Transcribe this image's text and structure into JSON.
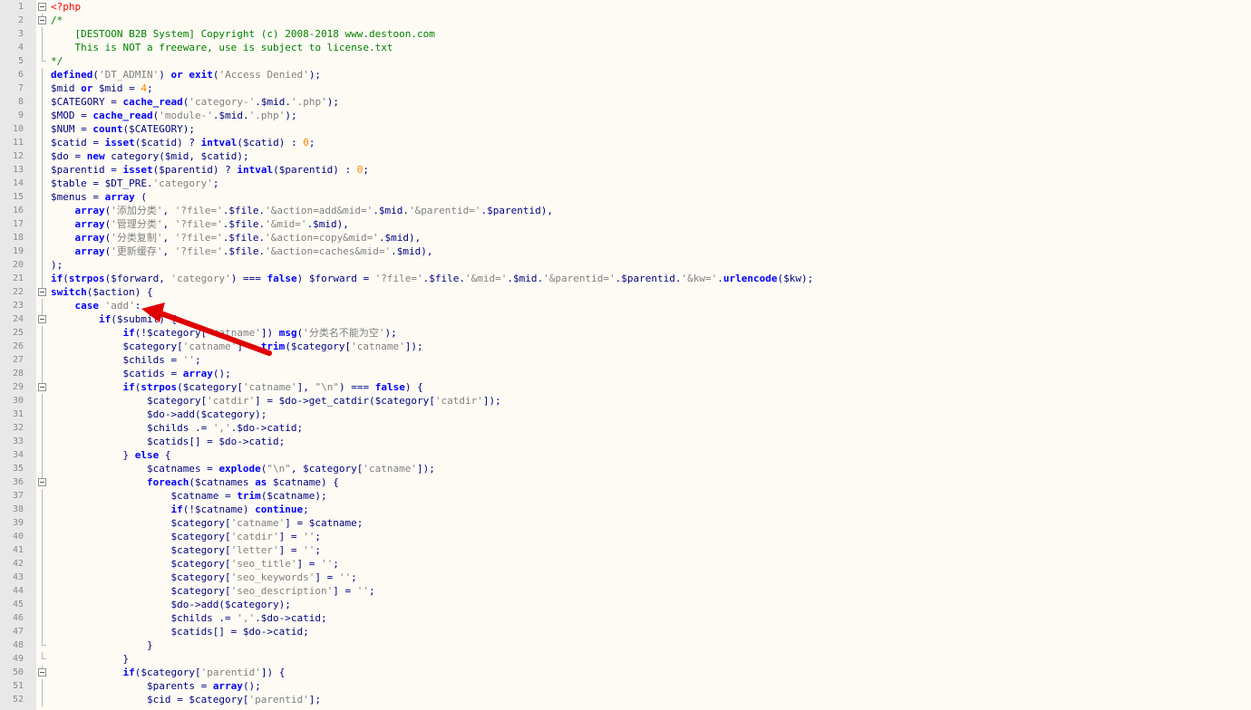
{
  "editor": {
    "colors": {
      "keyword": "#0000ff",
      "string": "#808080",
      "comment": "#008000",
      "php_tag": "#ff0000",
      "plain": "#000080",
      "number": "#ff8000",
      "annotation_arrow": "#e00000"
    },
    "lines": [
      {
        "n": "1",
        "text": "<?php",
        "fold": "box",
        "indent": 0
      },
      {
        "n": "2",
        "text": "/*",
        "fold": "box",
        "indent": 0
      },
      {
        "n": "3",
        "text": "    [DESTOON B2B System] Copyright (c) 2008-2018 www.destoon.com",
        "fold": "bar",
        "indent": 0
      },
      {
        "n": "4",
        "text": "    This is NOT a freeware, use is subject to license.txt",
        "fold": "bar",
        "indent": 0
      },
      {
        "n": "5",
        "text": "*/",
        "fold": "end",
        "indent": 0
      },
      {
        "n": "6",
        "text": "defined('DT_ADMIN') or exit('Access Denied');",
        "fold": "bar",
        "indent": 0
      },
      {
        "n": "7",
        "text": "$mid or $mid = 4;",
        "fold": "bar",
        "indent": 0
      },
      {
        "n": "8",
        "text": "$CATEGORY = cache_read('category-'.$mid.'.php');",
        "fold": "bar",
        "indent": 0
      },
      {
        "n": "9",
        "text": "$MOD = cache_read('module-'.$mid.'.php');",
        "fold": "bar",
        "indent": 0
      },
      {
        "n": "10",
        "text": "$NUM = count($CATEGORY);",
        "fold": "bar",
        "indent": 0
      },
      {
        "n": "11",
        "text": "$catid = isset($catid) ? intval($catid) : 0;",
        "fold": "bar",
        "indent": 0
      },
      {
        "n": "12",
        "text": "$do = new category($mid, $catid);",
        "fold": "bar",
        "indent": 0
      },
      {
        "n": "13",
        "text": "$parentid = isset($parentid) ? intval($parentid) : 0;",
        "fold": "bar",
        "indent": 0
      },
      {
        "n": "14",
        "text": "$table = $DT_PRE.'category';",
        "fold": "bar",
        "indent": 0
      },
      {
        "n": "15",
        "text": "$menus = array (",
        "fold": "bar",
        "indent": 0
      },
      {
        "n": "16",
        "text": "    array('添加分类', '?file='.$file.'&action=add&mid='.$mid.'&parentid='.$parentid),",
        "fold": "bar",
        "indent": 0
      },
      {
        "n": "17",
        "text": "    array('管理分类', '?file='.$file.'&mid='.$mid),",
        "fold": "bar",
        "indent": 0
      },
      {
        "n": "18",
        "text": "    array('分类复制', '?file='.$file.'&action=copy&mid='.$mid),",
        "fold": "bar",
        "indent": 0
      },
      {
        "n": "19",
        "text": "    array('更新缓存', '?file='.$file.'&action=caches&mid='.$mid),",
        "fold": "bar",
        "indent": 0
      },
      {
        "n": "20",
        "text": ");",
        "fold": "bar",
        "indent": 0
      },
      {
        "n": "21",
        "text": "if(strpos($forward, 'category') === false) $forward = '?file='.$file.'&mid='.$mid.'&parentid='.$parentid.'&kw='.urlencode($kw);",
        "fold": "bar",
        "indent": 0
      },
      {
        "n": "22",
        "text": "switch($action) {",
        "fold": "box",
        "indent": 0
      },
      {
        "n": "23",
        "text": "    case 'add':",
        "fold": "bar",
        "indent": 0
      },
      {
        "n": "24",
        "text": "        if($submit) {",
        "fold": "box",
        "indent": 0
      },
      {
        "n": "25",
        "text": "            if(!$category['catname']) msg('分类名不能为空');",
        "fold": "bar",
        "indent": 0
      },
      {
        "n": "26",
        "text": "            $category['catname'] = trim($category['catname']);",
        "fold": "bar",
        "indent": 0
      },
      {
        "n": "27",
        "text": "            $childs = '';",
        "fold": "bar",
        "indent": 0
      },
      {
        "n": "28",
        "text": "            $catids = array();",
        "fold": "bar",
        "indent": 0
      },
      {
        "n": "29",
        "text": "            if(strpos($category['catname'], \"\\n\") === false) {",
        "fold": "box",
        "indent": 0
      },
      {
        "n": "30",
        "text": "                $category['catdir'] = $do->get_catdir($category['catdir']);",
        "fold": "bar",
        "indent": 0
      },
      {
        "n": "31",
        "text": "                $do->add($category);",
        "fold": "bar",
        "indent": 0
      },
      {
        "n": "32",
        "text": "                $childs .= ','.$do->catid;",
        "fold": "bar",
        "indent": 0
      },
      {
        "n": "33",
        "text": "                $catids[] = $do->catid;",
        "fold": "bar",
        "indent": 0
      },
      {
        "n": "34",
        "text": "            } else {",
        "fold": "bar",
        "indent": 0
      },
      {
        "n": "35",
        "text": "                $catnames = explode(\"\\n\", $category['catname']);",
        "fold": "bar",
        "indent": 0
      },
      {
        "n": "36",
        "text": "                foreach($catnames as $catname) {",
        "fold": "box",
        "indent": 0
      },
      {
        "n": "37",
        "text": "                    $catname = trim($catname);",
        "fold": "bar",
        "indent": 0
      },
      {
        "n": "38",
        "text": "                    if(!$catname) continue;",
        "fold": "bar",
        "indent": 0
      },
      {
        "n": "39",
        "text": "                    $category['catname'] = $catname;",
        "fold": "bar",
        "indent": 0
      },
      {
        "n": "40",
        "text": "                    $category['catdir'] = '';",
        "fold": "bar",
        "indent": 0
      },
      {
        "n": "41",
        "text": "                    $category['letter'] = '';",
        "fold": "bar",
        "indent": 0
      },
      {
        "n": "42",
        "text": "                    $category['seo_title'] = '';",
        "fold": "bar",
        "indent": 0
      },
      {
        "n": "43",
        "text": "                    $category['seo_keywords'] = '';",
        "fold": "bar",
        "indent": 0
      },
      {
        "n": "44",
        "text": "                    $category['seo_description'] = '';",
        "fold": "bar",
        "indent": 0
      },
      {
        "n": "45",
        "text": "                    $do->add($category);",
        "fold": "bar",
        "indent": 0
      },
      {
        "n": "46",
        "text": "                    $childs .= ','.$do->catid;",
        "fold": "bar",
        "indent": 0
      },
      {
        "n": "47",
        "text": "                    $catids[] = $do->catid;",
        "fold": "bar",
        "indent": 0
      },
      {
        "n": "48",
        "text": "                }",
        "fold": "end",
        "indent": 0
      },
      {
        "n": "49",
        "text": "            }",
        "fold": "end",
        "indent": 0
      },
      {
        "n": "50",
        "text": "            if($category['parentid']) {",
        "fold": "box",
        "indent": 0
      },
      {
        "n": "51",
        "text": "                $parents = array();",
        "fold": "bar",
        "indent": 0
      },
      {
        "n": "52",
        "text": "                $cid = $category['parentid'];",
        "fold": "bar",
        "indent": 0
      }
    ]
  }
}
